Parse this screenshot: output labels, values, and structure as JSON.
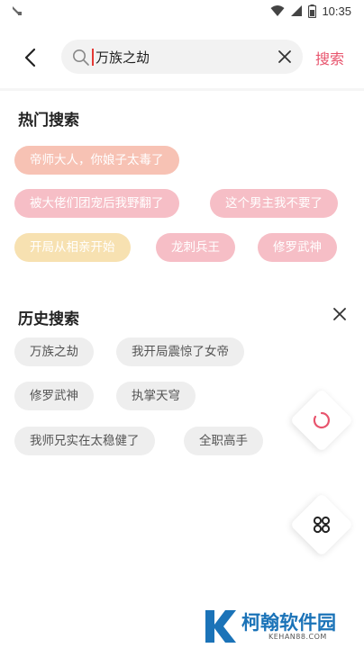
{
  "status_bar": {
    "time": "10:35"
  },
  "search": {
    "query": "万族之劫",
    "button_label": "搜索"
  },
  "hot": {
    "title": "热门搜索",
    "items": [
      {
        "label": "帝师大人，你娘子太毒了",
        "color": "#f7c2b4"
      },
      {
        "label": "被大佬们团宠后我野翻了",
        "color": "#f6bec6"
      },
      {
        "label": "这个男主我不要了",
        "color": "#f6bec6"
      },
      {
        "label": "开局从相亲开始",
        "color": "#f7e1b1"
      },
      {
        "label": "龙刺兵王",
        "color": "#f6bec6"
      },
      {
        "label": "修罗武神",
        "color": "#f6bec6"
      }
    ]
  },
  "history": {
    "title": "历史搜索",
    "items": [
      {
        "label": "万族之劫"
      },
      {
        "label": "我开局震惊了女帝"
      },
      {
        "label": "修罗武神"
      },
      {
        "label": "执掌天穹"
      },
      {
        "label": "我师兄实在太稳健了"
      },
      {
        "label": "全职高手"
      }
    ]
  },
  "watermark": {
    "name": "柯翰软件园",
    "url": "KEHAN88.COM"
  },
  "colors": {
    "accent": "#e8546d",
    "chip_gray": "#eeeeee"
  }
}
